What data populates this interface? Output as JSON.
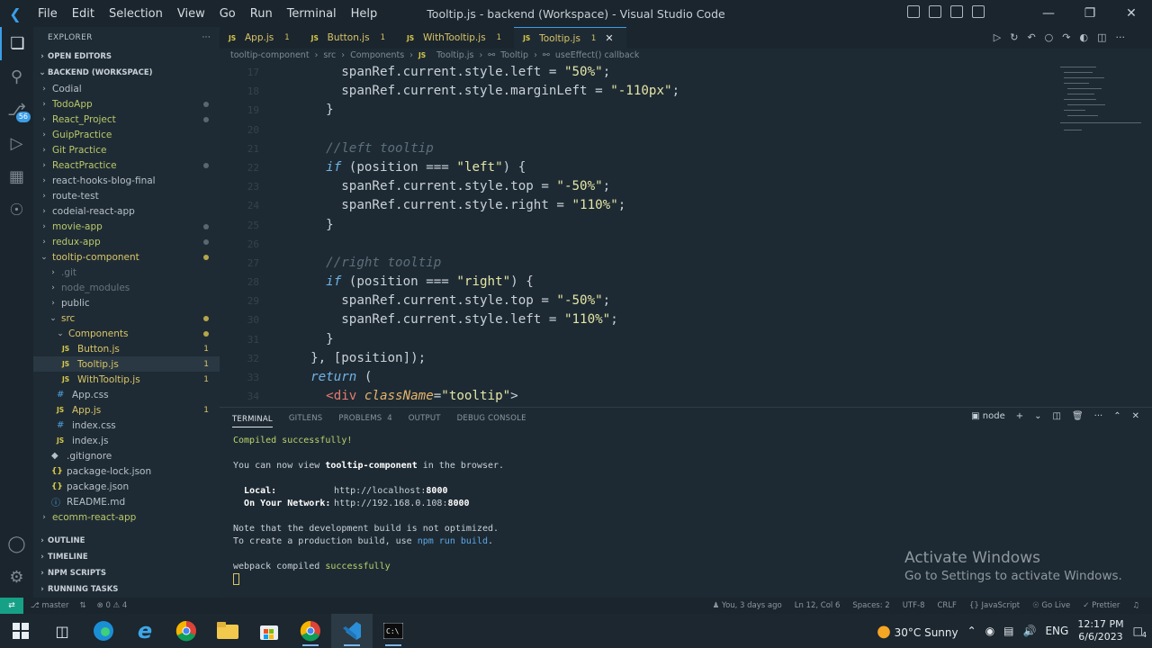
{
  "titlebar": {
    "menu": [
      "File",
      "Edit",
      "Selection",
      "View",
      "Go",
      "Run",
      "Terminal",
      "Help"
    ],
    "title": "Tooltip.js - backend (Workspace) - Visual Studio Code"
  },
  "activity": {
    "source_control_badge": "56"
  },
  "sidebar": {
    "header": "EXPLORER",
    "open_editors": "OPEN EDITORS",
    "workspace": "BACKEND (WORKSPACE)",
    "folders": [
      "Codial",
      "TodoApp",
      "React_Project",
      "GuipPractice",
      "Git Practice",
      "ReactPractice",
      "react-hooks-blog-final",
      "route-test",
      "codeial-react-app",
      "movie-app",
      "redux-app"
    ],
    "project": "tooltip-component",
    "project_children": [
      ".git",
      "node_modules",
      "public",
      "src"
    ],
    "components": "Components",
    "component_files": [
      {
        "name": "Button.js",
        "count": "1"
      },
      {
        "name": "Tooltip.js",
        "count": "1"
      },
      {
        "name": "WithTooltip.js",
        "count": "1"
      }
    ],
    "src_files": [
      "App.css",
      "App.js",
      "index.css",
      "index.js"
    ],
    "app_js_count": "1",
    "root_files": [
      ".gitignore",
      "package-lock.json",
      "package.json",
      "README.md"
    ],
    "last_folder": "ecomm-react-app",
    "bottom_sections": [
      "OUTLINE",
      "TIMELINE",
      "NPM SCRIPTS",
      "RUNNING TASKS"
    ]
  },
  "tabs": [
    {
      "label": "App.js",
      "num": "1"
    },
    {
      "label": "Button.js",
      "num": "1"
    },
    {
      "label": "WithTooltip.js",
      "num": "1"
    },
    {
      "label": "Tooltip.js",
      "num": "1"
    }
  ],
  "breadcrumb": [
    "tooltip-component",
    "src",
    "Components",
    "Tooltip.js",
    "Tooltip",
    "useEffect() callback"
  ],
  "code": {
    "lines": [
      {
        "n": "17",
        "t": "      spanRef.current.style.left = ",
        "s": "\"50%\"",
        "e": ";"
      },
      {
        "n": "18",
        "t": "      spanRef.current.style.marginLeft = ",
        "s": "\"-110px\"",
        "e": ";"
      },
      {
        "n": "19",
        "t": "    }"
      },
      {
        "n": "20",
        "t": ""
      },
      {
        "n": "21",
        "c": "    //left tooltip"
      },
      {
        "n": "22",
        "k": "    if",
        "t": " (position === ",
        "s": "\"left\"",
        "e": ") {"
      },
      {
        "n": "23",
        "t": "      spanRef.current.style.top = ",
        "s": "\"-50%\"",
        "e": ";"
      },
      {
        "n": "24",
        "t": "      spanRef.current.style.right = ",
        "s": "\"110%\"",
        "e": ";"
      },
      {
        "n": "25",
        "t": "    }"
      },
      {
        "n": "26",
        "t": ""
      },
      {
        "n": "27",
        "c": "    //right tooltip"
      },
      {
        "n": "28",
        "k": "    if",
        "t": " (position === ",
        "s": "\"right\"",
        "e": ") {"
      },
      {
        "n": "29",
        "t": "      spanRef.current.style.top = ",
        "s": "\"-50%\"",
        "e": ";"
      },
      {
        "n": "30",
        "t": "      spanRef.current.style.left = ",
        "s": "\"110%\"",
        "e": ";"
      },
      {
        "n": "31",
        "t": "    }"
      },
      {
        "n": "32",
        "t": "  }, [position]);"
      },
      {
        "n": "33",
        "k": "  return",
        "t": " ("
      },
      {
        "n": "34",
        "tag": "    <div ",
        "a": "className",
        "t": "=",
        "s": "\"tooltip\"",
        "e": ">"
      }
    ]
  },
  "panel": {
    "tabs": [
      "TERMINAL",
      "GITLENS",
      "PROBLEMS",
      "OUTPUT",
      "DEBUG CONSOLE"
    ],
    "problems_count": "4",
    "shell": "node",
    "terminal": {
      "compiled": "Compiled successfully!",
      "view_prefix": "You can now view ",
      "view_app": "tooltip-component",
      "view_suffix": " in the browser.",
      "local_label": "Local:",
      "local_url": "http://localhost:",
      "local_port": "8000",
      "network_label": "On Your Network:",
      "network_url": "http://192.168.0.108:",
      "network_port": "8000",
      "note1": "Note that the development build is not optimized.",
      "note2_prefix": "To create a production build, use ",
      "note2_cmd": "npm run build",
      "note2_suffix": ".",
      "webpack_prefix": "webpack compiled ",
      "webpack_status": "successfully"
    }
  },
  "watermark": {
    "line1": "Activate Windows",
    "line2": "Go to Settings to activate Windows."
  },
  "statusbar": {
    "branch": "master",
    "problems": "0 ⚠ 4",
    "blame": "You, 3 days ago",
    "position": "Ln 12, Col 6",
    "spaces": "Spaces: 2",
    "encoding": "UTF-8",
    "eol": "CRLF",
    "language": "JavaScript",
    "golive": "Go Live",
    "prettier": "Prettier"
  },
  "taskbar": {
    "weather": "30°C  Sunny",
    "lang": "ENG",
    "time": "12:17 PM",
    "date": "6/6/2023",
    "notifications": "4"
  },
  "colors": {
    "accent": "#3b9ee8",
    "remote": "#16a085",
    "warning": "#d9c567"
  }
}
